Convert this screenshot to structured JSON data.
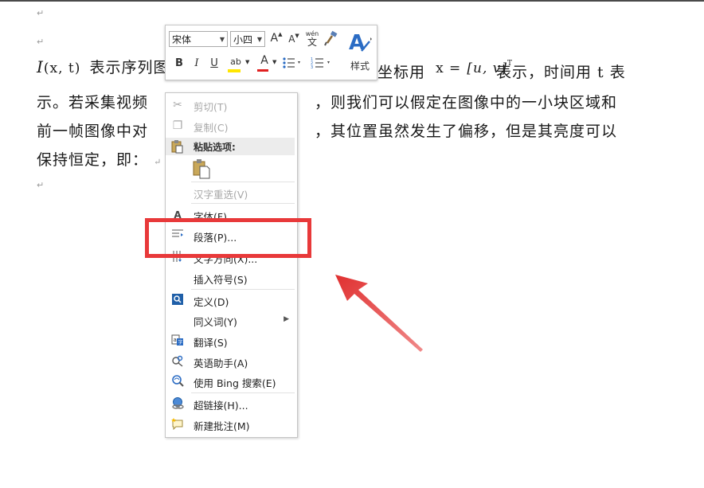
{
  "document": {
    "para_marks": [
      "↵",
      "↵",
      "↵",
      "↵"
    ],
    "line1": {
      "math_I": "I",
      "math_args": "(x, t)",
      "text_a": "表示序列图",
      "text_b": "坐标用",
      "math_x": "x =",
      "math_uv": "[u, v]",
      "math_T": "T",
      "text_c": "表示，时间用 t 表"
    },
    "line2": {
      "text_a": "示。若采集视频",
      "text_b": "，则我们可以假定在图像中的一小块区域和"
    },
    "line3": {
      "text_a": "前一帧图像中对",
      "text_b": "，其位置虽然发生了偏移，但是其亮度可以"
    },
    "line4": {
      "text_a": "保持恒定，即：",
      "mark": "↵"
    }
  },
  "mini_toolbar": {
    "font_name": "宋体",
    "font_size": "小四",
    "grow_font": "A",
    "shrink_font": "A",
    "phonetic_top": "wén",
    "phonetic_bottom": "文",
    "bold": "B",
    "italic": "I",
    "underline": "U",
    "highlight": "ab",
    "font_color": "A",
    "styles_label": "样式",
    "styles_icon": "A"
  },
  "context_menu": {
    "paste_header": "粘贴选项:",
    "items": [
      {
        "label": "剪切(T)",
        "icon": "scissors-icon",
        "disabled": true
      },
      {
        "label": "复制(C)",
        "icon": "copy-icon",
        "disabled": true
      },
      {
        "label": "汉字重选(V)",
        "icon": "",
        "disabled": true
      },
      {
        "label": "字体(F)...",
        "icon": "font-icon",
        "disabled": false
      },
      {
        "label": "段落(P)...",
        "icon": "paragraph-icon",
        "disabled": false
      },
      {
        "label": "文字方向(X)...",
        "icon": "text-direction-icon",
        "disabled": false
      },
      {
        "label": "插入符号(S)",
        "icon": "",
        "disabled": false
      },
      {
        "label": "定义(D)",
        "icon": "define-icon",
        "disabled": false
      },
      {
        "label": "同义词(Y)",
        "icon": "",
        "disabled": false,
        "submenu": true
      },
      {
        "label": "翻译(S)",
        "icon": "translate-icon",
        "disabled": false
      },
      {
        "label": "英语助手(A)",
        "icon": "english-assistant-icon",
        "disabled": false
      },
      {
        "label": "使用 Bing 搜索(E)",
        "icon": "bing-search-icon",
        "disabled": false
      },
      {
        "label": "超链接(H)...",
        "icon": "hyperlink-icon",
        "disabled": false
      },
      {
        "label": "新建批注(M)",
        "icon": "new-comment-icon",
        "disabled": false
      }
    ]
  },
  "colors": {
    "annotation_red": "#e8393a",
    "highlight_yellow": "#ffe600",
    "font_color_red": "#e02020",
    "styles_blue": "#2b6cc4"
  }
}
